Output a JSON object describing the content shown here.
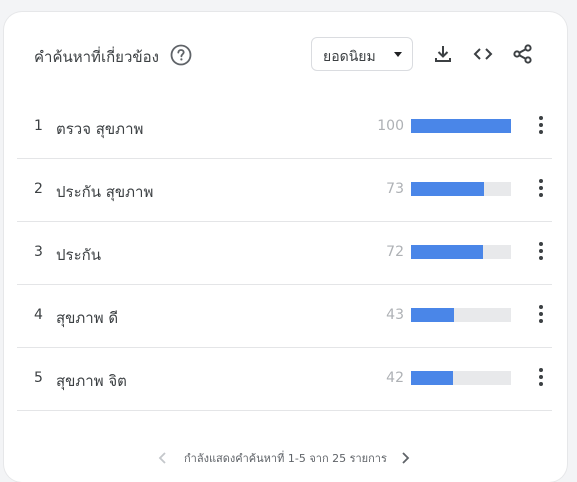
{
  "header": {
    "title": "คำค้นหาที่เกี่ยวข้อง",
    "help_icon": "help-circle-icon",
    "sort_select": {
      "selected": "ยอดนิยม"
    },
    "tools": [
      "download-icon",
      "embed-code-icon",
      "share-icon"
    ]
  },
  "rows": [
    {
      "rank": "1",
      "query": "ตรวจ สุขภาพ",
      "value": "100",
      "fraction": 1.0
    },
    {
      "rank": "2",
      "query": "ประกัน สุขภาพ",
      "value": "73",
      "fraction": 0.73
    },
    {
      "rank": "3",
      "query": "ประกัน",
      "value": "72",
      "fraction": 0.72
    },
    {
      "rank": "4",
      "query": "สุขภาพ ดี",
      "value": "43",
      "fraction": 0.43
    },
    {
      "rank": "5",
      "query": "สุขภาพ จิต",
      "value": "42",
      "fraction": 0.42
    }
  ],
  "pagination": {
    "text": "กำลังแสดงคำค้นหาที่ 1-5 จาก 25 รายการ"
  },
  "colors": {
    "accent": "#4a86e8",
    "track": "#e8e9eb",
    "text": "#3c4043",
    "muted": "#aeb1b5"
  }
}
